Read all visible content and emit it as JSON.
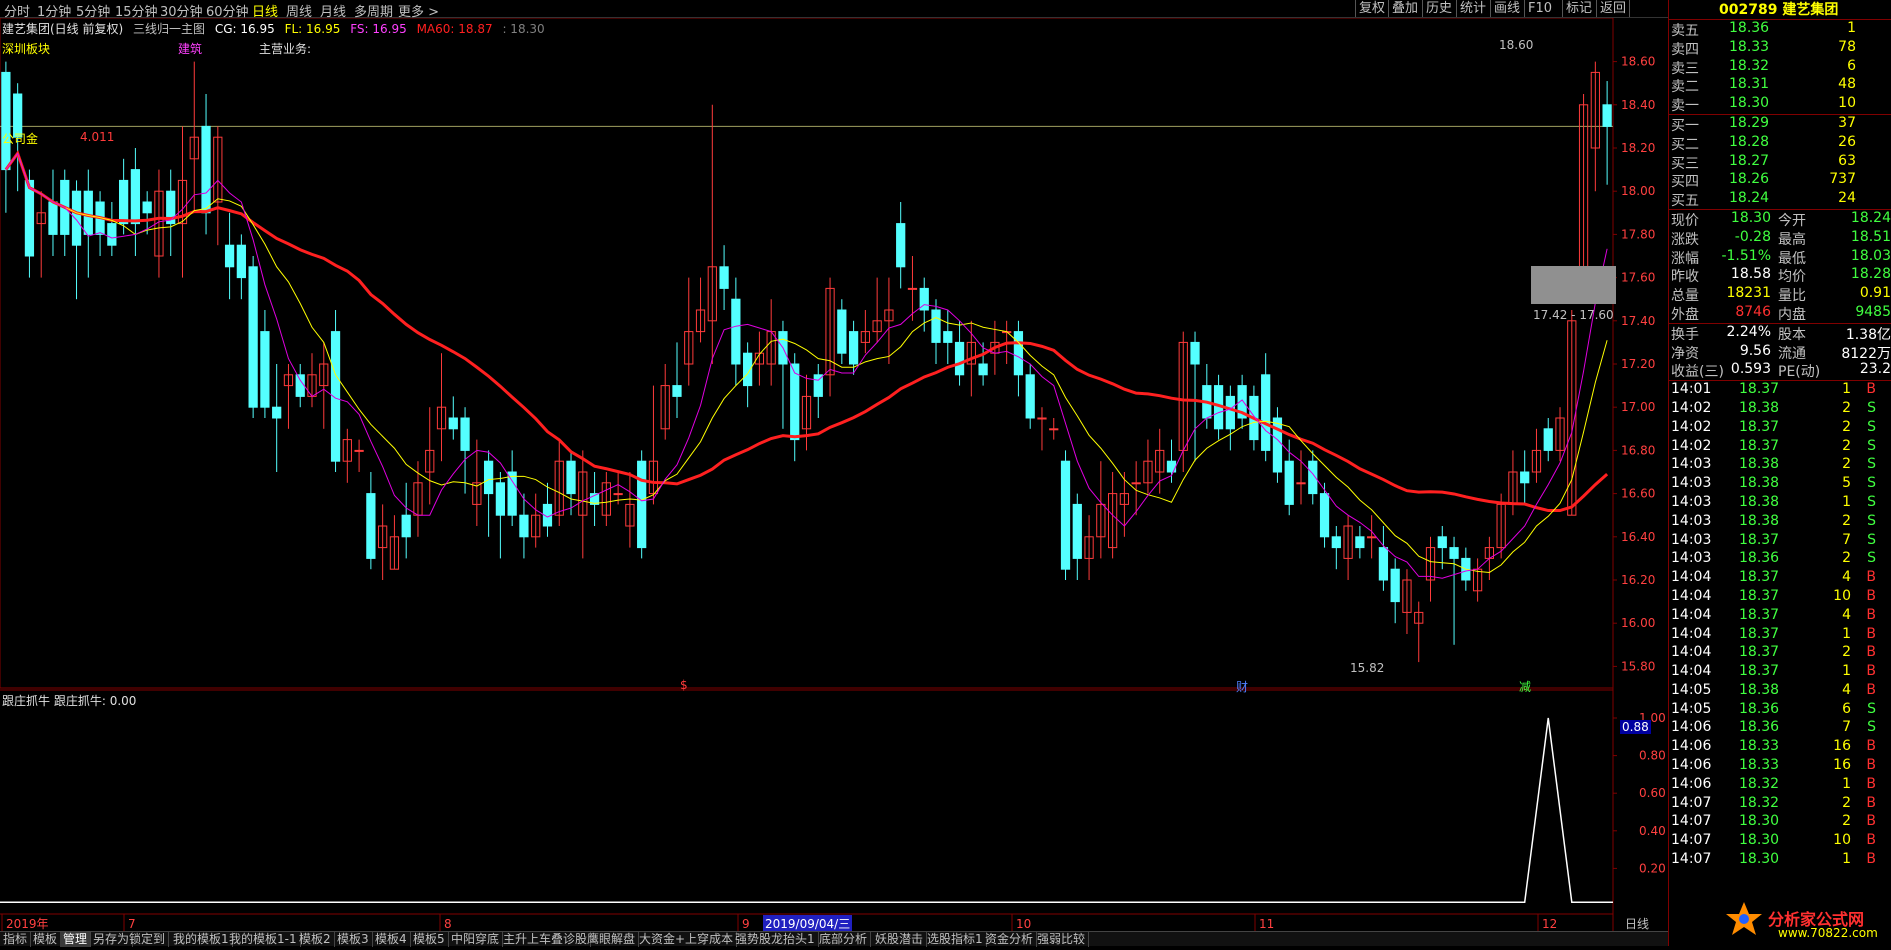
{
  "topbar": {
    "periods": [
      "分时",
      "1分钟",
      "5分钟",
      "15分钟",
      "30分钟",
      "60分钟",
      "日线",
      "周线",
      "月线",
      "多周期",
      "更多 >"
    ],
    "active_period": "日线",
    "right_buttons": [
      "复权",
      "叠加",
      "历史",
      "统计",
      "画线",
      "F10",
      "标记",
      "返回"
    ]
  },
  "main_chart": {
    "title": "建艺集团(日线 前复权)",
    "indicator": "三线归一主图",
    "cg": "CG: 16.95",
    "fl": "FL: 16.95",
    "fs": "FS: 16.95",
    "ma60": "MA60: 18.87",
    "extra": ": 18.30",
    "board": "深圳板块",
    "concept": "建筑",
    "business": "主营业务:",
    "left_tag": "公司金",
    "left_val": "4.011",
    "high_label": "18.60",
    "low_label": "15.82",
    "range_label": "17.42 - 17.60",
    "event_s": "$",
    "event_cai": "财",
    "event_jian": "减",
    "y_ticks": [
      "18.60",
      "18.40",
      "18.20",
      "18.00",
      "17.80",
      "17.60",
      "17.40",
      "17.20",
      "17.00",
      "16.80",
      "16.60",
      "16.40",
      "16.20",
      "16.00",
      "15.80"
    ],
    "ylim": [
      15.7,
      18.7
    ]
  },
  "sub_chart": {
    "title": "跟庄抓牛",
    "value": "跟庄抓牛: 0.00",
    "current": "0.88",
    "y_ticks": [
      "1.00",
      "0.80",
      "0.60",
      "0.40",
      "0.20"
    ]
  },
  "x_axis": {
    "labels": [
      "2019年",
      "7",
      "8",
      "9",
      "10",
      "11",
      "12"
    ],
    "cursor": "2019/09/04/三",
    "right_label": "日线"
  },
  "bottom_tabs": [
    "指标",
    "模板",
    "管理",
    "另存为",
    "锁定到",
    "我的模板1",
    "我的模板1-1",
    "模板2",
    "模板3",
    "模板4",
    "模板5",
    "中阳穿底",
    "主升上车叠诊股",
    "鹰眼解盘",
    "大资金+上穿成本",
    "强势股龙抬头1",
    "底部分析",
    "妖股潜击",
    "选股指标1",
    "资金分析",
    "强弱比较"
  ],
  "quote": {
    "code": "002789",
    "name": "建艺集团",
    "asks": [
      {
        "label": "卖五",
        "price": "18.36",
        "vol": "1"
      },
      {
        "label": "卖四",
        "price": "18.33",
        "vol": "78"
      },
      {
        "label": "卖三",
        "price": "18.32",
        "vol": "6"
      },
      {
        "label": "卖二",
        "price": "18.31",
        "vol": "48"
      },
      {
        "label": "卖一",
        "price": "18.30",
        "vol": "10"
      }
    ],
    "bids": [
      {
        "label": "买一",
        "price": "18.29",
        "vol": "37"
      },
      {
        "label": "买二",
        "price": "18.28",
        "vol": "26"
      },
      {
        "label": "买三",
        "price": "18.27",
        "vol": "63"
      },
      {
        "label": "买四",
        "price": "18.26",
        "vol": "737"
      },
      {
        "label": "买五",
        "price": "18.24",
        "vol": "24"
      }
    ],
    "stats": [
      {
        "l1": "现价",
        "v1": "18.30",
        "l2": "今开",
        "v2": "18.24"
      },
      {
        "l1": "涨跌",
        "v1": "-0.28",
        "l2": "最高",
        "v2": "18.51"
      },
      {
        "l1": "涨幅",
        "v1": "-1.51%",
        "l2": "最低",
        "v2": "18.03"
      },
      {
        "l1": "昨收",
        "v1": "18.58",
        "l2": "均价",
        "v2": "18.28"
      },
      {
        "l1": "总量",
        "v1": "18231",
        "l2": "量比",
        "v2": "0.91"
      },
      {
        "l1": "外盘",
        "v1": "8746",
        "l2": "内盘",
        "v2": "9485"
      }
    ],
    "fund": [
      {
        "l1": "换手",
        "v1": "2.24%",
        "l2": "股本",
        "v2": "1.38亿"
      },
      {
        "l1": "净资",
        "v1": "9.56",
        "l2": "流通",
        "v2": "8122万"
      },
      {
        "l1": "收益(三)",
        "v1": "0.593",
        "l2": "PE(动)",
        "v2": "23.2"
      }
    ],
    "ticks": [
      {
        "t": "14:01",
        "p": "18.37",
        "v": "1",
        "d": "B"
      },
      {
        "t": "14:02",
        "p": "18.38",
        "v": "2",
        "d": "S"
      },
      {
        "t": "14:02",
        "p": "18.37",
        "v": "2",
        "d": "S"
      },
      {
        "t": "14:02",
        "p": "18.37",
        "v": "2",
        "d": "S"
      },
      {
        "t": "14:03",
        "p": "18.38",
        "v": "2",
        "d": "S"
      },
      {
        "t": "14:03",
        "p": "18.38",
        "v": "5",
        "d": "S"
      },
      {
        "t": "14:03",
        "p": "18.38",
        "v": "1",
        "d": "S"
      },
      {
        "t": "14:03",
        "p": "18.38",
        "v": "2",
        "d": "S"
      },
      {
        "t": "14:03",
        "p": "18.37",
        "v": "7",
        "d": "S"
      },
      {
        "t": "14:03",
        "p": "18.36",
        "v": "2",
        "d": "S"
      },
      {
        "t": "14:04",
        "p": "18.37",
        "v": "4",
        "d": "B"
      },
      {
        "t": "14:04",
        "p": "18.37",
        "v": "10",
        "d": "B"
      },
      {
        "t": "14:04",
        "p": "18.37",
        "v": "4",
        "d": "B"
      },
      {
        "t": "14:04",
        "p": "18.37",
        "v": "1",
        "d": "B"
      },
      {
        "t": "14:04",
        "p": "18.37",
        "v": "2",
        "d": "B"
      },
      {
        "t": "14:04",
        "p": "18.37",
        "v": "1",
        "d": "B"
      },
      {
        "t": "14:05",
        "p": "18.38",
        "v": "4",
        "d": "B"
      },
      {
        "t": "14:05",
        "p": "18.36",
        "v": "6",
        "d": "S"
      },
      {
        "t": "14:06",
        "p": "18.36",
        "v": "7",
        "d": "S"
      },
      {
        "t": "14:06",
        "p": "18.33",
        "v": "16",
        "d": "B"
      },
      {
        "t": "14:06",
        "p": "18.33",
        "v": "16",
        "d": "B"
      },
      {
        "t": "14:06",
        "p": "18.32",
        "v": "1",
        "d": "B"
      },
      {
        "t": "14:07",
        "p": "18.32",
        "v": "2",
        "d": "B"
      },
      {
        "t": "14:07",
        "p": "18.30",
        "v": "2",
        "d": "B"
      },
      {
        "t": "14:07",
        "p": "18.30",
        "v": "10",
        "d": "B"
      },
      {
        "t": "14:07",
        "p": "18.30",
        "v": "1",
        "d": "B"
      }
    ]
  },
  "watermark": {
    "text": "分析家公式网",
    "url": "www.70822.com"
  },
  "colors": {
    "up": "#ff3b3b",
    "down": "#54ffff",
    "ma60": "#ff2020",
    "yellow": "#ffff00",
    "magenta": "#e000e0",
    "grid": "#800000"
  },
  "chart_data": {
    "type": "candlestick",
    "title": "建艺集团(日线 前复权)",
    "ylim": [
      15.7,
      18.7
    ],
    "candles": [
      [
        18.55,
        18.1,
        18.6,
        17.9
      ],
      [
        18.45,
        18.25,
        18.5,
        18.0
      ],
      [
        18.05,
        17.7,
        18.1,
        17.6
      ],
      [
        17.85,
        17.9,
        18.0,
        17.6
      ],
      [
        17.95,
        17.8,
        18.1,
        17.7
      ],
      [
        18.05,
        17.8,
        18.1,
        17.7
      ],
      [
        18.0,
        17.75,
        18.05,
        17.5
      ],
      [
        18.0,
        17.8,
        18.1,
        17.6
      ],
      [
        17.95,
        17.8,
        18.0,
        17.7
      ],
      [
        17.85,
        17.75,
        17.95,
        17.7
      ],
      [
        18.05,
        17.85,
        18.15,
        17.8
      ],
      [
        18.1,
        17.85,
        18.2,
        17.7
      ],
      [
        17.95,
        17.9,
        18.0,
        17.8
      ],
      [
        17.7,
        18.0,
        18.1,
        17.6
      ],
      [
        18.0,
        17.85,
        18.1,
        17.7
      ],
      [
        17.85,
        18.05,
        18.3,
        17.6
      ],
      [
        18.15,
        18.25,
        18.6,
        17.9
      ],
      [
        18.3,
        17.9,
        18.45,
        17.8
      ],
      [
        17.95,
        18.25,
        18.3,
        17.75
      ],
      [
        17.75,
        17.65,
        17.9,
        17.5
      ],
      [
        17.75,
        17.6,
        17.8,
        17.5
      ],
      [
        17.65,
        17.0,
        17.7,
        16.95
      ],
      [
        17.35,
        17.0,
        17.45,
        16.95
      ],
      [
        17.0,
        16.95,
        17.2,
        16.7
      ],
      [
        17.1,
        17.15,
        17.2,
        16.9
      ],
      [
        17.15,
        17.05,
        17.2,
        17.0
      ],
      [
        17.05,
        17.15,
        17.25,
        17.0
      ],
      [
        17.1,
        17.2,
        17.3,
        16.9
      ],
      [
        17.35,
        16.75,
        17.45,
        16.7
      ],
      [
        16.75,
        16.85,
        16.9,
        16.65
      ],
      [
        16.8,
        16.8,
        16.85,
        16.7
      ],
      [
        16.6,
        16.3,
        16.7,
        16.25
      ],
      [
        16.35,
        16.45,
        16.55,
        16.2
      ],
      [
        16.25,
        16.4,
        16.5,
        16.25
      ],
      [
        16.5,
        16.4,
        16.65,
        16.3
      ],
      [
        16.5,
        16.65,
        16.75,
        16.4
      ],
      [
        16.7,
        16.8,
        17.0,
        16.55
      ],
      [
        16.9,
        17.0,
        17.25,
        16.75
      ],
      [
        16.95,
        16.9,
        17.05,
        16.85
      ],
      [
        16.95,
        16.8,
        17.0,
        16.6
      ],
      [
        16.55,
        16.65,
        16.85,
        16.45
      ],
      [
        16.75,
        16.6,
        16.8,
        16.4
      ],
      [
        16.65,
        16.5,
        16.7,
        16.3
      ],
      [
        16.7,
        16.5,
        16.8,
        16.45
      ],
      [
        16.5,
        16.4,
        16.6,
        16.3
      ],
      [
        16.4,
        16.5,
        16.6,
        16.35
      ],
      [
        16.55,
        16.45,
        16.65,
        16.4
      ],
      [
        16.5,
        16.75,
        16.85,
        16.45
      ],
      [
        16.75,
        16.6,
        16.8,
        16.5
      ],
      [
        16.5,
        16.7,
        16.8,
        16.3
      ],
      [
        16.6,
        16.55,
        16.7,
        16.45
      ],
      [
        16.5,
        16.65,
        16.7,
        16.45
      ],
      [
        16.6,
        16.6,
        16.7,
        16.55
      ],
      [
        16.45,
        16.55,
        16.7,
        16.35
      ],
      [
        16.75,
        16.35,
        16.8,
        16.3
      ],
      [
        16.6,
        16.75,
        17.1,
        16.55
      ],
      [
        16.9,
        17.1,
        17.2,
        16.85
      ],
      [
        17.1,
        17.05,
        17.3,
        16.95
      ],
      [
        17.2,
        17.35,
        17.6,
        17.1
      ],
      [
        17.35,
        17.45,
        17.6,
        17.3
      ],
      [
        17.4,
        17.65,
        18.4,
        17.2
      ],
      [
        17.65,
        17.55,
        17.75,
        17.45
      ],
      [
        17.5,
        17.2,
        17.6,
        17.1
      ],
      [
        17.25,
        17.1,
        17.3,
        17.0
      ],
      [
        17.2,
        17.25,
        17.35,
        17.1
      ],
      [
        17.2,
        17.35,
        17.5,
        17.1
      ],
      [
        17.35,
        17.2,
        17.4,
        16.9
      ],
      [
        17.2,
        16.85,
        17.25,
        16.75
      ],
      [
        16.9,
        17.05,
        17.15,
        16.8
      ],
      [
        17.15,
        17.05,
        17.2,
        16.95
      ],
      [
        17.15,
        17.55,
        17.6,
        17.05
      ],
      [
        17.45,
        17.25,
        17.5,
        17.2
      ],
      [
        17.35,
        17.2,
        17.4,
        17.15
      ],
      [
        17.3,
        17.35,
        17.45,
        17.25
      ],
      [
        17.35,
        17.4,
        17.6,
        17.3
      ],
      [
        17.4,
        17.45,
        17.6,
        17.2
      ],
      [
        17.85,
        17.65,
        17.95,
        17.55
      ],
      [
        17.55,
        17.55,
        17.7,
        17.4
      ],
      [
        17.55,
        17.45,
        17.6,
        17.35
      ],
      [
        17.45,
        17.3,
        17.5,
        17.2
      ],
      [
        17.35,
        17.3,
        17.45,
        17.2
      ],
      [
        17.3,
        17.15,
        17.4,
        17.1
      ],
      [
        17.2,
        17.3,
        17.4,
        17.05
      ],
      [
        17.2,
        17.15,
        17.3,
        17.1
      ],
      [
        17.25,
        17.3,
        17.4,
        17.15
      ],
      [
        17.35,
        17.35,
        17.4,
        17.2
      ],
      [
        17.35,
        17.15,
        17.4,
        17.05
      ],
      [
        17.15,
        16.95,
        17.2,
        16.9
      ],
      [
        16.95,
        16.95,
        17.0,
        16.8
      ],
      [
        16.9,
        16.9,
        16.95,
        16.85
      ],
      [
        16.75,
        16.25,
        16.8,
        16.2
      ],
      [
        16.55,
        16.3,
        16.6,
        16.2
      ],
      [
        16.3,
        16.4,
        16.5,
        16.2
      ],
      [
        16.4,
        16.55,
        16.75,
        16.3
      ],
      [
        16.35,
        16.6,
        16.7,
        16.3
      ],
      [
        16.55,
        16.6,
        16.7,
        16.4
      ],
      [
        16.65,
        16.65,
        16.75,
        16.5
      ],
      [
        16.65,
        16.75,
        16.85,
        16.6
      ],
      [
        16.7,
        16.8,
        16.9,
        16.6
      ],
      [
        16.75,
        16.7,
        16.85,
        16.65
      ],
      [
        16.8,
        17.3,
        17.35,
        16.7
      ],
      [
        17.3,
        17.2,
        17.35,
        16.75
      ],
      [
        17.1,
        16.95,
        17.2,
        16.9
      ],
      [
        17.1,
        16.9,
        17.15,
        16.85
      ],
      [
        17.05,
        16.9,
        17.1,
        16.8
      ],
      [
        17.1,
        16.95,
        17.15,
        16.9
      ],
      [
        17.05,
        16.85,
        17.1,
        16.8
      ],
      [
        17.15,
        16.8,
        17.25,
        16.75
      ],
      [
        16.95,
        16.7,
        17.0,
        16.65
      ],
      [
        16.75,
        16.55,
        16.85,
        16.5
      ],
      [
        16.65,
        16.65,
        16.8,
        16.55
      ],
      [
        16.75,
        16.6,
        16.8,
        16.55
      ],
      [
        16.6,
        16.4,
        16.65,
        16.35
      ],
      [
        16.4,
        16.35,
        16.45,
        16.25
      ],
      [
        16.3,
        16.45,
        16.5,
        16.2
      ],
      [
        16.4,
        16.35,
        16.45,
        16.3
      ],
      [
        16.4,
        16.4,
        16.5,
        16.3
      ],
      [
        16.35,
        16.2,
        16.45,
        16.15
      ],
      [
        16.25,
        16.1,
        16.3,
        16.0
      ],
      [
        16.05,
        16.2,
        16.25,
        15.95
      ],
      [
        16.0,
        16.05,
        16.1,
        15.82
      ],
      [
        16.2,
        16.35,
        16.4,
        16.1
      ],
      [
        16.4,
        16.35,
        16.45,
        16.25
      ],
      [
        16.35,
        16.3,
        16.4,
        15.9
      ],
      [
        16.3,
        16.2,
        16.35,
        16.15
      ],
      [
        16.15,
        16.25,
        16.3,
        16.1
      ],
      [
        16.3,
        16.35,
        16.4,
        16.2
      ],
      [
        16.35,
        16.55,
        16.6,
        16.3
      ],
      [
        16.55,
        16.7,
        16.8,
        16.5
      ],
      [
        16.7,
        16.65,
        16.8,
        16.55
      ],
      [
        16.7,
        16.8,
        16.9,
        16.65
      ],
      [
        16.9,
        16.8,
        16.95,
        16.75
      ],
      [
        16.8,
        16.95,
        17.0,
        16.75
      ],
      [
        16.5,
        17.4,
        17.45,
        16.5
      ],
      [
        17.6,
        18.4,
        18.45,
        17.55
      ],
      [
        18.2,
        18.55,
        18.6,
        18.0
      ],
      [
        18.4,
        18.3,
        18.51,
        18.03
      ]
    ]
  }
}
